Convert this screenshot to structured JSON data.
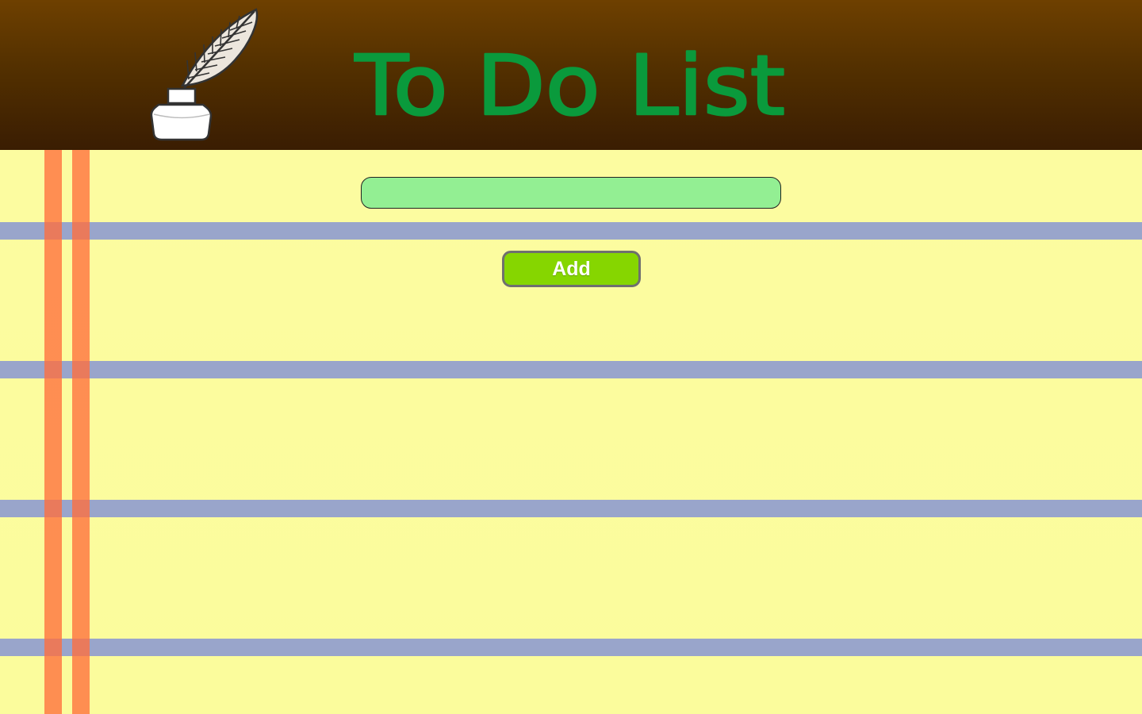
{
  "header": {
    "title": "To Do List",
    "logo_icon": "quill-inkwell-icon"
  },
  "form": {
    "task_input_value": "",
    "task_input_placeholder": "",
    "add_label": "Add"
  },
  "colors": {
    "header_top": "#6e4000",
    "header_bottom": "#3a1d02",
    "title": "#0a9a3c",
    "paper": "#fbfd9f",
    "rule_line": "#99a5cb",
    "margin_line": "#ff7a45",
    "input_fill": "#93ef93",
    "button_fill": "#86d600"
  }
}
